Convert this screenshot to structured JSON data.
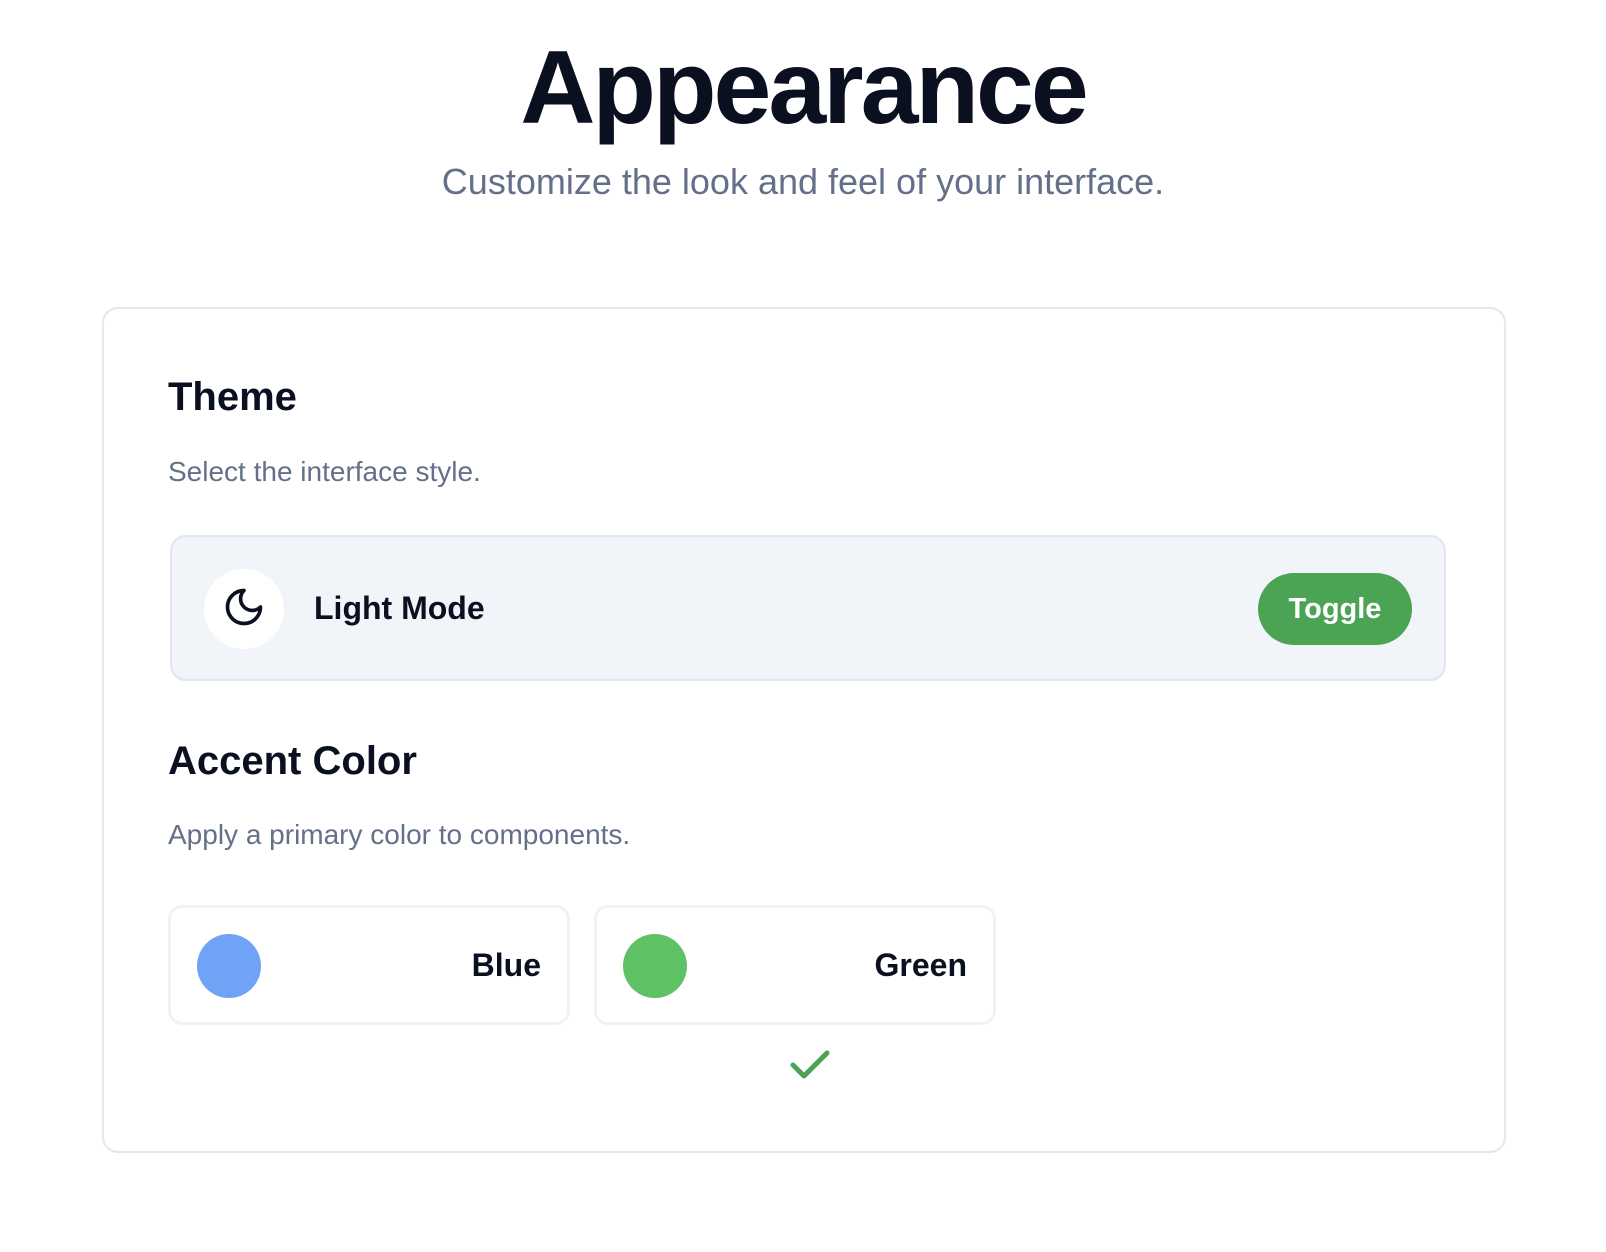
{
  "header": {
    "title": "Appearance",
    "subtitle": "Customize the look and feel of your interface."
  },
  "theme": {
    "title": "Theme",
    "description": "Select the interface style.",
    "mode_label": "Light Mode",
    "mode_icon": "moon-icon",
    "toggle_label": "Toggle"
  },
  "accent": {
    "title": "Accent Color",
    "description": "Apply a primary color to components.",
    "options": [
      {
        "label": "Blue",
        "color": "#70a2f5",
        "selected": false
      },
      {
        "label": "Green",
        "color": "#5ec165",
        "selected": true
      }
    ],
    "selected_icon": "checkmark-icon"
  },
  "colors": {
    "toggle_bg": "#4ba354",
    "check": "#4ba354",
    "title_text": "#0b1020",
    "muted_text": "#64708a"
  }
}
